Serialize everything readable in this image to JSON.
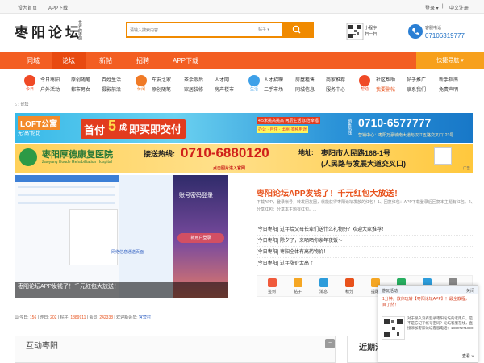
{
  "topbar": {
    "set_home": "设为首页",
    "app_download": "APP下载",
    "login": "登录 ▾",
    "separator": "|",
    "register": "中文注册"
  },
  "header": {
    "logo_text": "枣阳论坛",
    "logo_subtitle": "世界的枣阳",
    "search_placeholder": "请输入搜索内容",
    "search_scope": "帖子 ▾",
    "mini_program": "小程序",
    "scan": "扫一扫",
    "hotline_label": "客服电话",
    "hotline_number": "07106319777"
  },
  "nav": {
    "items": [
      "同城",
      "论坛",
      "新帖",
      "招聘",
      "APP下载"
    ],
    "active_index": 1,
    "quick_nav": "快捷导航 ▾"
  },
  "categories": [
    {
      "label": "今日",
      "color": "#f04a26",
      "links": [
        "今日枣阳",
        "户外活动"
      ]
    },
    {
      "label": "",
      "color": "#",
      "links": [
        "原创随笔",
        "都市男女"
      ]
    },
    {
      "label": "",
      "color": "#",
      "links": [
        "百姓生活",
        "摄影前沿"
      ]
    },
    {
      "label": "休闲",
      "color": "#f07a26",
      "links": [
        "车友之家",
        "原创随笔"
      ]
    },
    {
      "label": "",
      "color": "#",
      "links": [
        "茶余饭后",
        "家居装修"
      ]
    },
    {
      "label": "",
      "color": "#",
      "links": [
        "人才网",
        "房产楼市"
      ]
    },
    {
      "label": "生活",
      "color": "#3da0e8",
      "links": [
        "人才招聘",
        "二手市场"
      ]
    },
    {
      "label": "",
      "color": "#",
      "links": [
        "房屋租售",
        "同城信息"
      ]
    },
    {
      "label": "",
      "color": "#",
      "links": [
        "商家推荐",
        "服务中心"
      ]
    },
    {
      "label": "帮助",
      "color": "#f04a26",
      "links": [
        "社区帮助",
        "我要删帖"
      ]
    },
    {
      "label": "",
      "color": "#",
      "links": [
        "帖子推广",
        "联系我们"
      ]
    },
    {
      "label": "",
      "color": "#",
      "links": [
        "新手指南",
        "免责声明"
      ]
    }
  ],
  "breadcrumb": {
    "home_icon": "home-icon",
    "sep": "›",
    "current": "论坛"
  },
  "banner1": {
    "brand": "LOFT公寓",
    "slogan_tag": "无\"高\"伦比",
    "headline_a": "首付",
    "headline_num": "5",
    "headline_b": "成",
    "headline_c": "即买即交付",
    "feature_1": "4.5米挑高挑高  两层生活,加倍幸福",
    "feature_2": "办公 · 自住 · 出租  多种用途",
    "sales_label": "销售热线",
    "phone": "0710-6577777",
    "address": "营销中心：枣阳万豪城南大道与汉江五路交叉口123号"
  },
  "banner2": {
    "hospital_name": "枣阳厚德康复医院",
    "hospital_en": "Zaoyang Houde Rehabilitation Hospital",
    "hotline_label": "接送热线:",
    "phone": "0710-6880120",
    "click_hint": "点击图片进入官网",
    "address_label": "地址:",
    "address_1": "枣阳市人民路168-1号",
    "address_2": "(人民路与发展大道交叉口)",
    "ad_tag": "广告"
  },
  "slider": {
    "caption": "枣阳论坛APP发钱了！千元红包大放送！",
    "phone_title": "账号密码登录",
    "phone_button": "新用户登录",
    "phone_hint": "网络信息通送页面"
  },
  "promo": {
    "title": "枣阳论坛APP发钱了！千元红包大放送！",
    "text": "下载APP，登录帐号，转发朋友圈，就能获得枣阳论坛发放的红包！1、回复红包：APP下载登录后回复本主题有红包。2、分享红包：分享本主题有红包。..."
  },
  "news": [
    "[今日枣阳] 过年给父母长辈们送什么礼物好？欢迎大家推荐！",
    "[今日枣阳] 除夕了，来晒晒你家年夜饭～",
    "[今日枣阳] 枣阳全体有高药物价！",
    "[今日枣阳] 过年涨价太高了"
  ],
  "iconrow": [
    {
      "label": "签到",
      "color": "#f05a3c"
    },
    {
      "label": "帖子",
      "color": "#f5a623"
    },
    {
      "label": "消息",
      "color": "#2d9cdb"
    },
    {
      "label": "积分",
      "color": "#e8521c"
    },
    {
      "label": "提醒",
      "color": "#f5a623"
    },
    {
      "label": "资料",
      "color": "#27ae60"
    },
    {
      "label": "好友",
      "color": "#2d9cdb"
    },
    {
      "label": "设置",
      "color": "#888888"
    }
  ],
  "stats": {
    "today_label": "今日:",
    "today": "156",
    "yesterday_label": "昨日:",
    "yesterday": "202",
    "posts_label": "帖子:",
    "posts": "1889911",
    "members_label": "会员:",
    "members": "242338",
    "newest_label": "欢迎新会员:",
    "newest": "官营村"
  },
  "sections": {
    "hudong": "互动枣阳",
    "jinqi": "近期活"
  },
  "popup": {
    "title": "游玩活动",
    "close": "关闭",
    "body": "1分钟，教你玩转【枣阳论坛APP】！最全教程，一目了然！",
    "desc": "对于很久没有登录枣阳论坛的老用户，是不是忘记了帐号密码？论坛客服在线，直接添加枣阳论坛客服电话：18607271890",
    "more": "查看 »"
  },
  "colors": {
    "nav": "#f35e22",
    "accent": "#f08a00",
    "promo": "#e8521c"
  }
}
